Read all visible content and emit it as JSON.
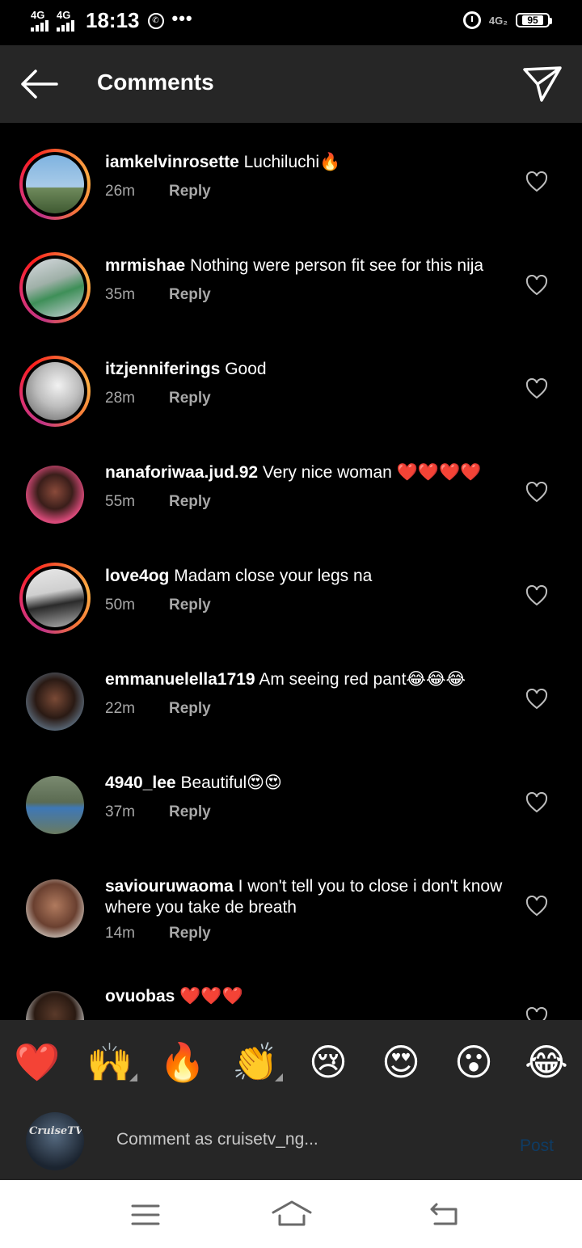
{
  "status_bar": {
    "sim1": "4G",
    "sim2": "4G",
    "time": "18:13",
    "more": "•••",
    "network": "4G₂",
    "battery": "95"
  },
  "header": {
    "title": "Comments"
  },
  "comments": [
    {
      "user": "iamkelvinrosette",
      "text": "Luchiluchi🔥",
      "time": "26m",
      "reply": "Reply"
    },
    {
      "user": "mrmishae",
      "text": "Nothing were person fit see for this nija",
      "time": "35m",
      "reply": "Reply"
    },
    {
      "user": "itzjenniferings",
      "text": "Good",
      "time": "28m",
      "reply": "Reply"
    },
    {
      "user": "nanaforiwaa.jud.92",
      "text": "Very nice woman ❤️❤️❤️❤️",
      "time": "55m",
      "reply": "Reply"
    },
    {
      "user": "love4og",
      "text": "Madam close your legs na",
      "time": "50m",
      "reply": "Reply"
    },
    {
      "user": "emmanuelella1719",
      "text": "Am seeing red pant😂😂😂",
      "time": "22m",
      "reply": "Reply"
    },
    {
      "user": "4940_lee",
      "text": "Beautiful😍😍",
      "time": "37m",
      "reply": "Reply"
    },
    {
      "user": "saviouruwaoma",
      "text": "I won't tell you to close i don't know where you take de breath",
      "time": "14m",
      "reply": "Reply"
    },
    {
      "user": "ovuobas",
      "text": "❤️❤️❤️",
      "time": "",
      "reply": ""
    }
  ],
  "emoji_bar": [
    "❤️",
    "🙌",
    "🔥",
    "👏",
    "😢",
    "😍",
    "😮",
    "😂"
  ],
  "composer": {
    "avatar_text": "CruiseTV",
    "placeholder": "Comment as cruisetv_ng...",
    "post_label": "Post"
  }
}
